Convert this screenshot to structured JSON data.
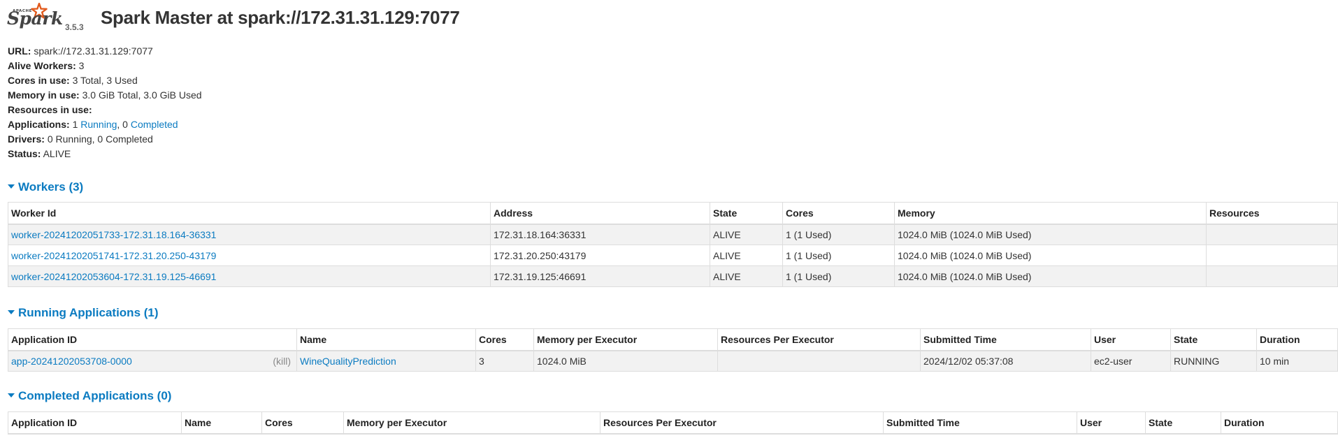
{
  "header": {
    "logo_brand": "Spark",
    "logo_apache": "APACHE",
    "version": "3.5.3",
    "title": "Spark Master at spark://172.31.31.129:7077"
  },
  "summary": {
    "url_label": "URL:",
    "url_value": "spark://172.31.31.129:7077",
    "alive_workers_label": "Alive Workers:",
    "alive_workers_value": "3",
    "cores_label": "Cores in use:",
    "cores_value": "3 Total, 3 Used",
    "memory_label": "Memory in use:",
    "memory_value": "3.0 GiB Total, 3.0 GiB Used",
    "resources_label": "Resources in use:",
    "applications_label": "Applications:",
    "applications_running_count": "1",
    "applications_running_link": "Running",
    "applications_sep": ", 0",
    "applications_completed_link": "Completed",
    "drivers_label": "Drivers:",
    "drivers_value": "0 Running, 0 Completed",
    "status_label": "Status:",
    "status_value": "ALIVE"
  },
  "workers": {
    "title": "Workers (3)",
    "headers": [
      "Worker Id",
      "Address",
      "State",
      "Cores",
      "Memory",
      "Resources"
    ],
    "rows": [
      [
        "worker-20241202051733-172.31.18.164-36331",
        "172.31.18.164:36331",
        "ALIVE",
        "1 (1 Used)",
        "1024.0 MiB (1024.0 MiB Used)",
        ""
      ],
      [
        "worker-20241202051741-172.31.20.250-43179",
        "172.31.20.250:43179",
        "ALIVE",
        "1 (1 Used)",
        "1024.0 MiB (1024.0 MiB Used)",
        ""
      ],
      [
        "worker-20241202053604-172.31.19.125-46691",
        "172.31.19.125:46691",
        "ALIVE",
        "1 (1 Used)",
        "1024.0 MiB (1024.0 MiB Used)",
        ""
      ]
    ]
  },
  "running_apps": {
    "title": "Running Applications (1)",
    "headers": [
      "Application ID",
      "Name",
      "Cores",
      "Memory per Executor",
      "Resources Per Executor",
      "Submitted Time",
      "User",
      "State",
      "Duration"
    ],
    "rows": [
      {
        "app_id": "app-20241202053708-0000",
        "kill": "(kill)",
        "name": "WineQualityPrediction",
        "cores": "3",
        "memory": "1024.0 MiB",
        "resources": "",
        "submitted": "2024/12/02 05:37:08",
        "user": "ec2-user",
        "state": "RUNNING",
        "duration": "10 min"
      }
    ]
  },
  "completed_apps": {
    "title": "Completed Applications (0)",
    "headers": [
      "Application ID",
      "Name",
      "Cores",
      "Memory per Executor",
      "Resources Per Executor",
      "Submitted Time",
      "User",
      "State",
      "Duration"
    ]
  },
  "colors": {
    "link": "#0b7bc1",
    "logo_star": "#e25a1c",
    "row_stripe": "#f2f2f2"
  }
}
